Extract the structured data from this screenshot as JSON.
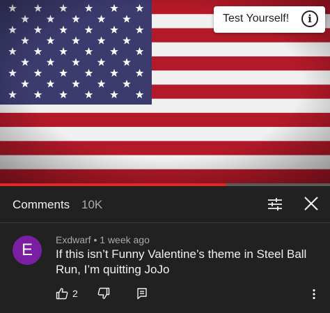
{
  "video": {
    "test_yourself_label": "Test Yourself!",
    "progress": 0.685,
    "colors": {
      "red_stripe": "#b31928",
      "white_stripe": "#f0f0f0",
      "canton": "#3c3b6e",
      "progress": "#e52521"
    }
  },
  "comments_panel": {
    "title": "Comments",
    "count": "10K",
    "icons": {
      "sort": "sort-sliders-icon",
      "close": "close-icon"
    }
  },
  "comment": {
    "avatar_letter": "E",
    "avatar_color": "#7b1fa2",
    "author": "Exdwarf",
    "separator": "•",
    "time": "1 week ago",
    "text": "If this isn’t Funny Valentine’s theme in Steel Ball Run, I’m quitting JoJo",
    "likes": "2",
    "icons": {
      "like": "thumbs-up-icon",
      "dislike": "thumbs-down-icon",
      "reply": "reply-icon",
      "more": "more-vert-icon"
    }
  }
}
